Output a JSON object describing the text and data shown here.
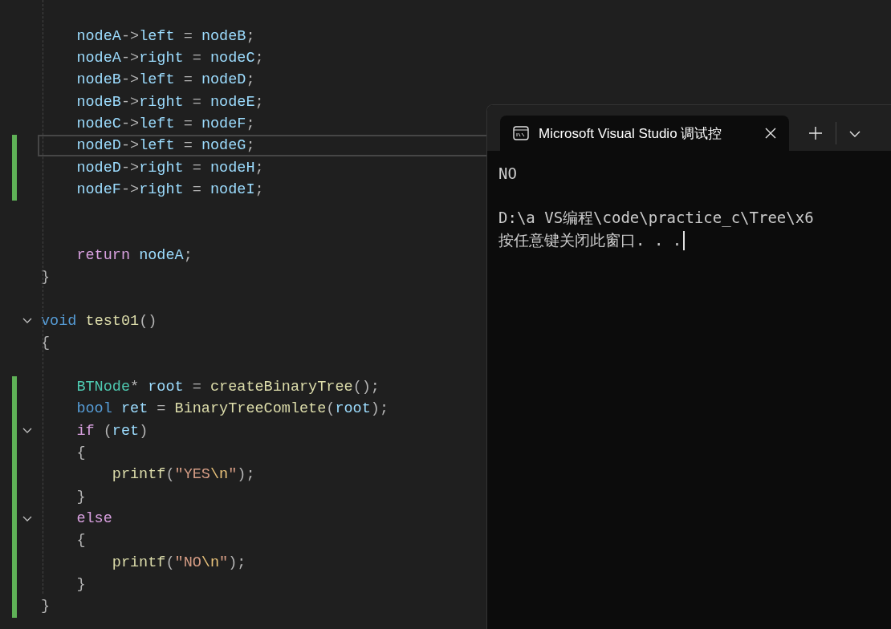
{
  "editor": {
    "lines": [
      {
        "changed": false,
        "selected": false
      },
      {
        "changed": false,
        "selected": false,
        "tokens": [
          {
            "kind": "variable",
            "text": "    nodeA"
          },
          {
            "kind": "punct",
            "text": "->"
          },
          {
            "kind": "variable",
            "text": "left"
          },
          {
            "kind": "punct",
            "text": " = "
          },
          {
            "kind": "variable",
            "text": "nodeB"
          },
          {
            "kind": "punct",
            "text": ";"
          }
        ]
      },
      {
        "changed": false,
        "selected": false,
        "tokens": [
          {
            "kind": "variable",
            "text": "    nodeA"
          },
          {
            "kind": "punct",
            "text": "->"
          },
          {
            "kind": "variable",
            "text": "right"
          },
          {
            "kind": "punct",
            "text": " = "
          },
          {
            "kind": "variable",
            "text": "nodeC"
          },
          {
            "kind": "punct",
            "text": ";"
          }
        ]
      },
      {
        "changed": false,
        "selected": false,
        "tokens": [
          {
            "kind": "variable",
            "text": "    nodeB"
          },
          {
            "kind": "punct",
            "text": "->"
          },
          {
            "kind": "variable",
            "text": "left"
          },
          {
            "kind": "punct",
            "text": " = "
          },
          {
            "kind": "variable",
            "text": "nodeD"
          },
          {
            "kind": "punct",
            "text": ";"
          }
        ]
      },
      {
        "changed": false,
        "selected": false,
        "tokens": [
          {
            "kind": "variable",
            "text": "    nodeB"
          },
          {
            "kind": "punct",
            "text": "->"
          },
          {
            "kind": "variable",
            "text": "right"
          },
          {
            "kind": "punct",
            "text": " = "
          },
          {
            "kind": "variable",
            "text": "nodeE"
          },
          {
            "kind": "punct",
            "text": ";"
          }
        ]
      },
      {
        "changed": false,
        "selected": false,
        "tokens": [
          {
            "kind": "variable",
            "text": "    nodeC"
          },
          {
            "kind": "punct",
            "text": "->"
          },
          {
            "kind": "variable",
            "text": "left"
          },
          {
            "kind": "punct",
            "text": " = "
          },
          {
            "kind": "variable",
            "text": "nodeF"
          },
          {
            "kind": "punct",
            "text": ";"
          }
        ]
      },
      {
        "changed": true,
        "selected": true,
        "tokens": [
          {
            "kind": "variable",
            "text": "    nodeD"
          },
          {
            "kind": "punct",
            "text": "->"
          },
          {
            "kind": "variable",
            "text": "left"
          },
          {
            "kind": "punct",
            "text": " = "
          },
          {
            "kind": "variable",
            "text": "nodeG"
          },
          {
            "kind": "punct",
            "text": ";"
          }
        ]
      },
      {
        "changed": true,
        "selected": false,
        "tokens": [
          {
            "kind": "variable",
            "text": "    nodeD"
          },
          {
            "kind": "punct",
            "text": "->"
          },
          {
            "kind": "variable",
            "text": "right"
          },
          {
            "kind": "punct",
            "text": " = "
          },
          {
            "kind": "variable",
            "text": "nodeH"
          },
          {
            "kind": "punct",
            "text": ";"
          }
        ]
      },
      {
        "changed": true,
        "selected": false,
        "tokens": [
          {
            "kind": "variable",
            "text": "    nodeF"
          },
          {
            "kind": "punct",
            "text": "->"
          },
          {
            "kind": "variable",
            "text": "right"
          },
          {
            "kind": "punct",
            "text": " = "
          },
          {
            "kind": "variable",
            "text": "nodeI"
          },
          {
            "kind": "punct",
            "text": ";"
          }
        ]
      },
      {
        "changed": false,
        "selected": false
      },
      {
        "changed": false,
        "selected": false
      },
      {
        "changed": false,
        "selected": false,
        "tokens": [
          {
            "kind": "control",
            "text": "    return"
          },
          {
            "kind": "variable",
            "text": " nodeA"
          },
          {
            "kind": "punct",
            "text": ";"
          }
        ]
      },
      {
        "changed": false,
        "selected": false,
        "tokens": [
          {
            "kind": "punct",
            "text": "}"
          }
        ]
      },
      {
        "changed": false,
        "selected": false
      },
      {
        "changed": false,
        "selected": false,
        "expanded": true,
        "tokens": [
          {
            "kind": "keyword",
            "text": "void"
          },
          {
            "kind": "function",
            "text": " test01"
          },
          {
            "kind": "punct",
            "text": "()"
          }
        ]
      },
      {
        "changed": false,
        "selected": false,
        "tokens": [
          {
            "kind": "punct",
            "text": "{"
          }
        ]
      },
      {
        "changed": false,
        "selected": false
      },
      {
        "changed": true,
        "selected": false,
        "tokens": [
          {
            "kind": "type",
            "text": "    BTNode"
          },
          {
            "kind": "punct",
            "text": "* "
          },
          {
            "kind": "variable",
            "text": "root"
          },
          {
            "kind": "punct",
            "text": " = "
          },
          {
            "kind": "function",
            "text": "createBinaryTree"
          },
          {
            "kind": "punct",
            "text": "();"
          }
        ]
      },
      {
        "changed": true,
        "selected": false,
        "tokens": [
          {
            "kind": "keyword",
            "text": "    bool"
          },
          {
            "kind": "variable",
            "text": " ret"
          },
          {
            "kind": "punct",
            "text": " = "
          },
          {
            "kind": "function",
            "text": "BinaryTreeComlete"
          },
          {
            "kind": "punct",
            "text": "("
          },
          {
            "kind": "variable",
            "text": "root"
          },
          {
            "kind": "punct",
            "text": ");"
          }
        ]
      },
      {
        "changed": true,
        "selected": false,
        "expanded": true,
        "tokens": [
          {
            "kind": "control",
            "text": "    if"
          },
          {
            "kind": "punct",
            "text": " ("
          },
          {
            "kind": "variable",
            "text": "ret"
          },
          {
            "kind": "punct",
            "text": ")"
          }
        ]
      },
      {
        "changed": true,
        "selected": false,
        "tokens": [
          {
            "kind": "punct",
            "text": "    {"
          }
        ]
      },
      {
        "changed": true,
        "selected": false,
        "tokens": [
          {
            "kind": "function",
            "text": "        printf"
          },
          {
            "kind": "punct",
            "text": "("
          },
          {
            "kind": "string",
            "text": "\"YES"
          },
          {
            "kind": "escape",
            "text": "\\n"
          },
          {
            "kind": "string",
            "text": "\""
          },
          {
            "kind": "punct",
            "text": ");"
          }
        ]
      },
      {
        "changed": true,
        "selected": false,
        "tokens": [
          {
            "kind": "punct",
            "text": "    }"
          }
        ]
      },
      {
        "changed": true,
        "selected": false,
        "expanded": true,
        "tokens": [
          {
            "kind": "control",
            "text": "    else"
          }
        ]
      },
      {
        "changed": true,
        "selected": false,
        "tokens": [
          {
            "kind": "punct",
            "text": "    {"
          }
        ]
      },
      {
        "changed": true,
        "selected": false,
        "tokens": [
          {
            "kind": "function",
            "text": "        printf"
          },
          {
            "kind": "punct",
            "text": "("
          },
          {
            "kind": "string",
            "text": "\"NO"
          },
          {
            "kind": "escape",
            "text": "\\n"
          },
          {
            "kind": "string",
            "text": "\""
          },
          {
            "kind": "punct",
            "text": ");"
          }
        ]
      },
      {
        "changed": true,
        "selected": false,
        "tokens": [
          {
            "kind": "punct",
            "text": "    }"
          }
        ]
      },
      {
        "changed": true,
        "selected": false,
        "tokens": [
          {
            "kind": "punct",
            "text": "}"
          }
        ]
      }
    ]
  },
  "terminal": {
    "tabs": [
      {
        "title": "Microsoft Visual Studio 调试控",
        "selected": true
      }
    ],
    "output": [
      {
        "lines": [
          "NO"
        ]
      },
      {
        "lines": [
          "D:\\a VS编程\\code\\practice_c\\Tree\\x6",
          "按任意键关闭此窗口. . ."
        ]
      }
    ]
  }
}
